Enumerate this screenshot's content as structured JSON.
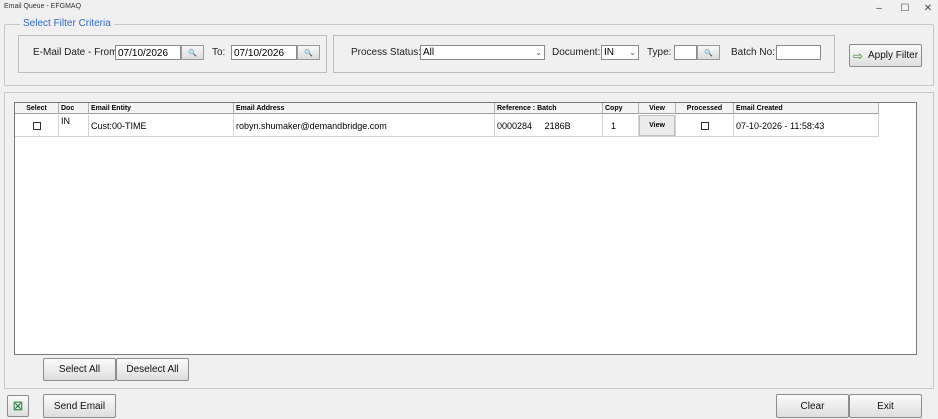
{
  "window": {
    "title": "Email Queue - EFGMAQ",
    "minimize": "–",
    "maximize": "☐",
    "close": "✕"
  },
  "filter": {
    "legend": "Select Filter Criteria",
    "date_from_label": "E-Mail Date - From:",
    "date_from": "07/10/2026",
    "date_to_label": "To:",
    "date_to": "07/10/2026",
    "process_status_label": "Process Status:",
    "process_status": "All",
    "document_label": "Document:",
    "document": "IN",
    "type_label": "Type:",
    "type": "",
    "batch_label": "Batch No:",
    "batch": "",
    "apply_label": "Apply Filter"
  },
  "grid": {
    "columns": [
      "Select",
      "Doc",
      "Email Entity",
      "Email Address",
      "Reference : Batch",
      "Copy",
      "View",
      "Processed",
      "Email Created"
    ],
    "rows": [
      {
        "doc": "IN",
        "entity": "Cust:00-TIME",
        "email": "robyn.shumaker@demandbridge.com",
        "reference": "0000284",
        "batch": "2186B",
        "copy": "1",
        "view": "View",
        "created": "07-10-2026 - 11:58:43"
      }
    ]
  },
  "actions": {
    "select_all": "Select All",
    "deselect_all": "Deselect All",
    "send_email": "Send Email",
    "clear": "Clear",
    "exit": "Exit",
    "excel_icon_glyph": "⊠",
    "apply_icon_glyph": "⇨",
    "search_glyph": "🔍"
  },
  "colors": {
    "accent": "#2f6ad0",
    "excel_green": "#1e7a3a"
  }
}
